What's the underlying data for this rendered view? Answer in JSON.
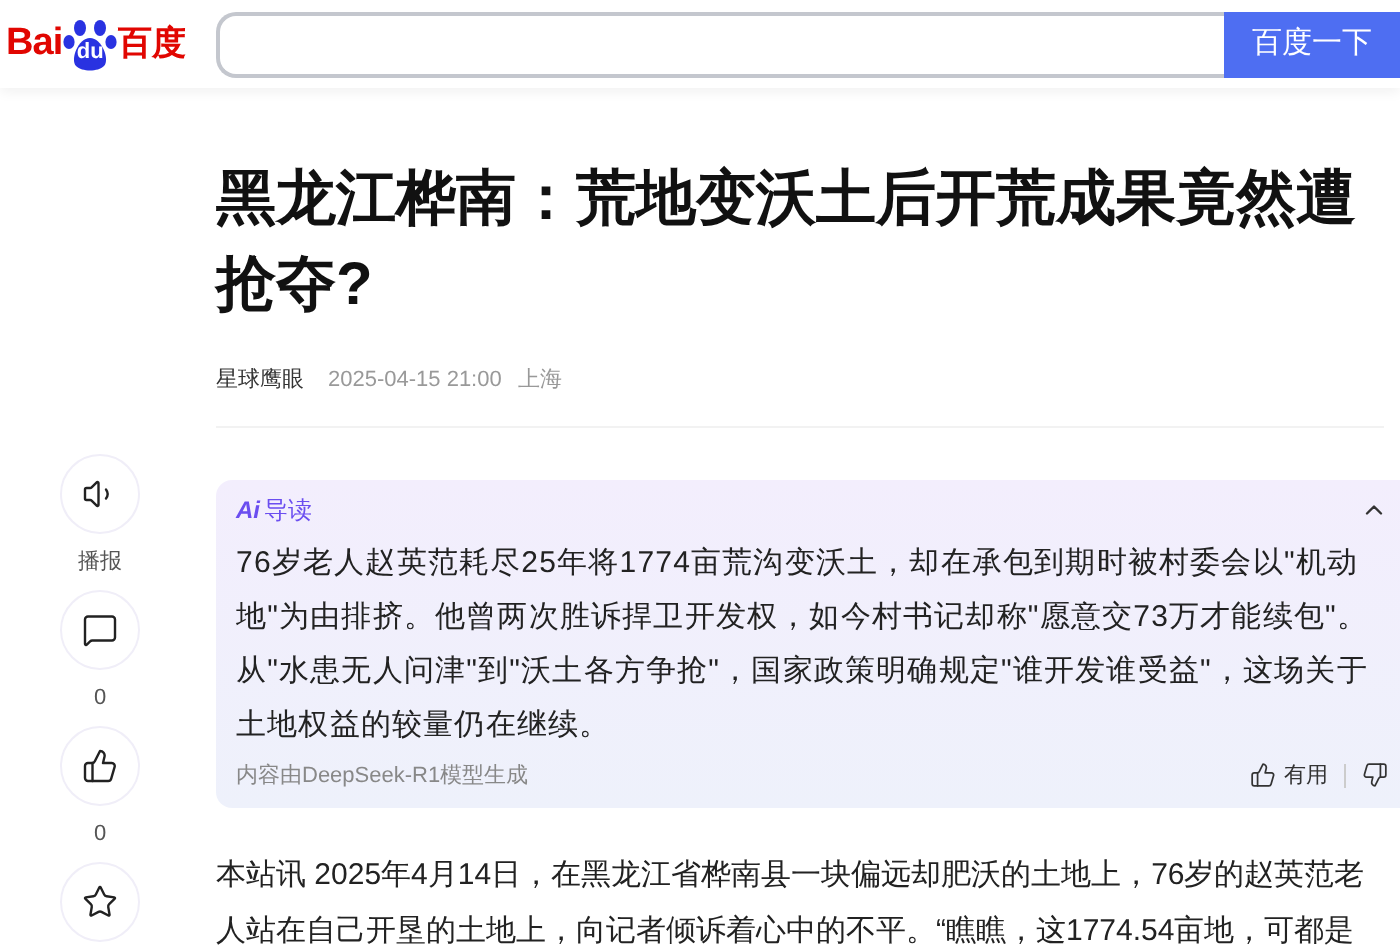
{
  "header": {
    "logo": {
      "left": "Bai",
      "paw": "du",
      "right": "百度"
    },
    "search": {
      "button": "百度一下"
    }
  },
  "article": {
    "title": "黑龙江桦南：荒地变沃土后开荒成果竟然遭抢夺?",
    "author": "星球鹰眼",
    "time": "2025-04-15 21:00",
    "location": "上海"
  },
  "sidebar": [
    {
      "kind": "audio",
      "label": "播报"
    },
    {
      "kind": "comment",
      "label": "0"
    },
    {
      "kind": "like",
      "label": "0"
    },
    {
      "kind": "star"
    }
  ],
  "ai_summary": {
    "badge": "Ai",
    "title": "导读",
    "expanded": true,
    "text": "76岁老人赵英范耗尽25年将1774亩荒沟变沃土，却在承包到期时被村委会以\"机动地\"为由排挤。他曾两次胜诉捍卫开发权，如今村书记却称\"愿意交73万才能续包\"。从\"水患无人问津\"到\"沃土各方争抢\"，国家政策明确规定\"谁开发谁受益\"，这场关于土地权益的较量仍在继续。",
    "source": "内容由DeepSeek-R1模型生成",
    "useful": "有用"
  },
  "body": "本站讯 2025年4月14日，在黑龙江省桦南县一块偏远却肥沃的土地上，76岁的赵英范老人站在自己开垦的土地上，向记者倾诉着心中的不平。“瞧瞧，这1774.54亩地，可都是"
}
